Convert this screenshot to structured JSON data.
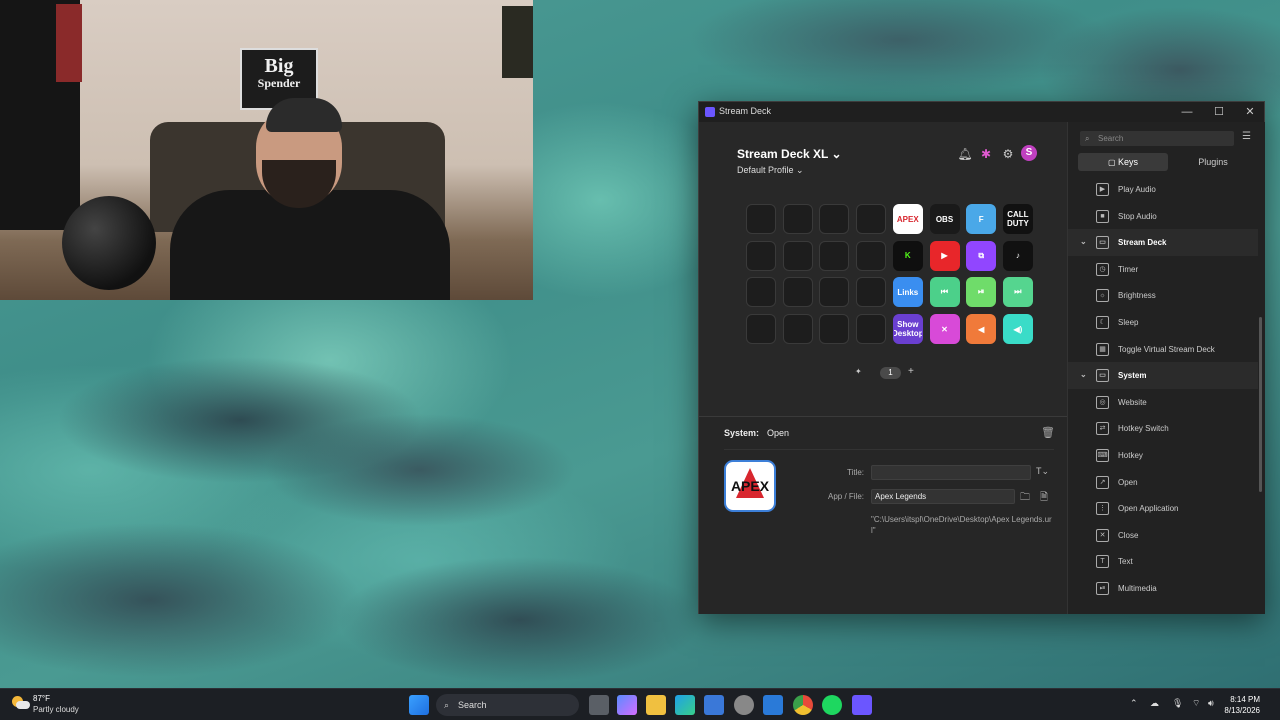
{
  "webcam": {
    "sign_line1": "Big",
    "sign_line2": "Spender"
  },
  "window": {
    "title": "Stream Deck",
    "minimize": "—",
    "maximize": "☐",
    "close": "✕"
  },
  "deck": {
    "device_name": "Stream Deck XL",
    "device_chevron": "⌄",
    "profile_name": "Default Profile",
    "profile_chevron": "⌄",
    "icons": {
      "notifications": "bell-icon",
      "marketplace": "marketplace-icon",
      "settings": "gear-icon"
    },
    "avatar_letter": "S",
    "keys": [
      {
        "label": "",
        "color": "#1d1d1d"
      },
      {
        "label": "",
        "color": "#1d1d1d"
      },
      {
        "label": "",
        "color": "#1d1d1d"
      },
      {
        "label": "",
        "color": "#1d1d1d"
      },
      {
        "label": "APEX",
        "color": "#ffffff",
        "text": "#d8262e"
      },
      {
        "label": "OBS",
        "color": "#1a1a1a"
      },
      {
        "label": "F",
        "color": "#4aa8e8"
      },
      {
        "label": "CALL DUTY",
        "color": "#111111"
      },
      {
        "label": "",
        "color": "#1d1d1d"
      },
      {
        "label": "",
        "color": "#1d1d1d"
      },
      {
        "label": "",
        "color": "#1d1d1d"
      },
      {
        "label": "",
        "color": "#1d1d1d"
      },
      {
        "label": "K",
        "color": "#0f0f0f",
        "text": "#53fc18"
      },
      {
        "label": "▶",
        "color": "#e8262a"
      },
      {
        "label": "⧉",
        "color": "#9146ff"
      },
      {
        "label": "♪",
        "color": "#111111"
      },
      {
        "label": "",
        "color": "#1d1d1d"
      },
      {
        "label": "",
        "color": "#1d1d1d"
      },
      {
        "label": "",
        "color": "#1d1d1d"
      },
      {
        "label": "",
        "color": "#1d1d1d"
      },
      {
        "label": "Links",
        "color": "#3a8ef0"
      },
      {
        "label": "⏮",
        "color": "#4cd08a"
      },
      {
        "label": "⏯",
        "color": "#6fdc6a"
      },
      {
        "label": "⏭",
        "color": "#55d58f"
      },
      {
        "label": "",
        "color": "#1d1d1d"
      },
      {
        "label": "",
        "color": "#1d1d1d"
      },
      {
        "label": "",
        "color": "#1d1d1d"
      },
      {
        "label": "",
        "color": "#1d1d1d"
      },
      {
        "label": "Show Desktop",
        "color": "#6a3fd0"
      },
      {
        "label": "✕",
        "color": "#d84ad8"
      },
      {
        "label": "◀",
        "color": "#f07a3a"
      },
      {
        "label": "◀)",
        "color": "#3adcc8"
      }
    ],
    "page_prev": "✦",
    "page_current": "1",
    "page_add": "+"
  },
  "inspector": {
    "category": "System:",
    "action": "Open",
    "icon_label": "APEX",
    "title_label": "Title:",
    "title_value": "",
    "title_font_btn": "T⌄",
    "app_label": "App / File:",
    "app_value": "Apex Legends",
    "path": "\"C:\\Users\\itspl\\OneDrive\\Desktop\\Apex Legends.url\""
  },
  "actions_panel": {
    "search_placeholder": "Search",
    "tab_keys": "Keys",
    "tab_plugins": "Plugins",
    "rows": [
      {
        "label": "Play Audio",
        "type": "item"
      },
      {
        "label": "Stop Audio",
        "type": "item"
      },
      {
        "label": "Stream Deck",
        "type": "category"
      },
      {
        "label": "Timer",
        "type": "item"
      },
      {
        "label": "Brightness",
        "type": "item"
      },
      {
        "label": "Sleep",
        "type": "item"
      },
      {
        "label": "Toggle Virtual Stream Deck",
        "type": "item"
      },
      {
        "label": "System",
        "type": "category"
      },
      {
        "label": "Website",
        "type": "item"
      },
      {
        "label": "Hotkey Switch",
        "type": "item"
      },
      {
        "label": "Hotkey",
        "type": "item"
      },
      {
        "label": "Open",
        "type": "item"
      },
      {
        "label": "Open Application",
        "type": "item"
      },
      {
        "label": "Close",
        "type": "item"
      },
      {
        "label": "Text",
        "type": "item"
      },
      {
        "label": "Multimedia",
        "type": "item"
      }
    ]
  },
  "taskbar": {
    "temperature": "87°F",
    "condition": "Partly cloudy",
    "search_label": "Search",
    "time": "8:14 PM",
    "date": "8/13/2026"
  }
}
